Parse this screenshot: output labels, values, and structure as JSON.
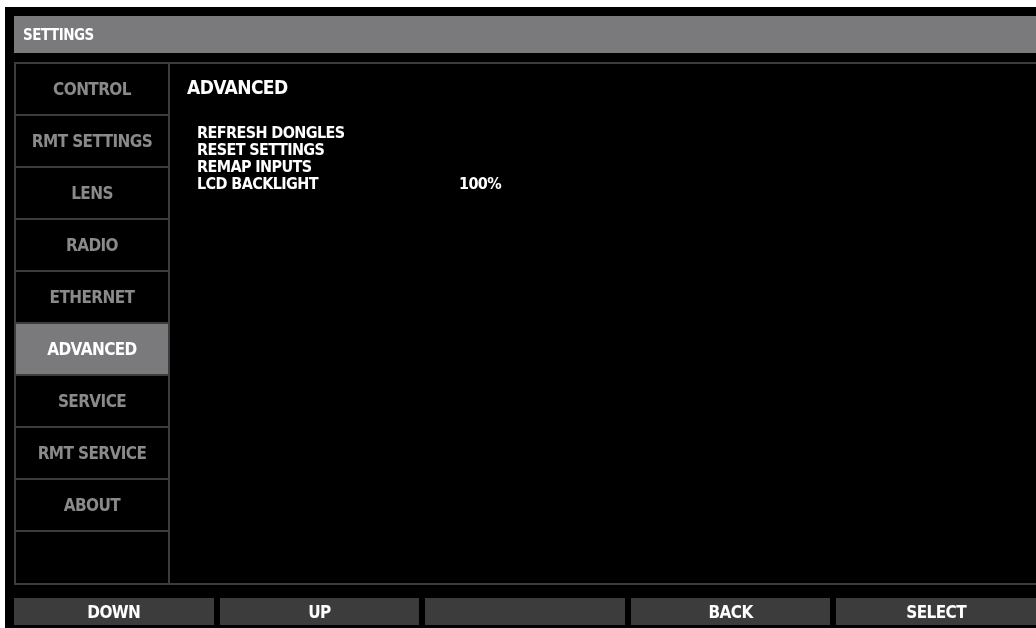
{
  "window": {
    "title": "SETTINGS"
  },
  "sidebar": {
    "items": [
      {
        "label": "CONTROL",
        "selected": false
      },
      {
        "label": "RMT SETTINGS",
        "selected": false
      },
      {
        "label": "LENS",
        "selected": false
      },
      {
        "label": "RADIO",
        "selected": false
      },
      {
        "label": "ETHERNET",
        "selected": false
      },
      {
        "label": "ADVANCED",
        "selected": true
      },
      {
        "label": "SERVICE",
        "selected": false
      },
      {
        "label": "RMT SERVICE",
        "selected": false
      },
      {
        "label": "ABOUT",
        "selected": false
      }
    ]
  },
  "panel": {
    "heading": "ADVANCED",
    "rows": [
      {
        "label": "REFRESH DONGLES"
      },
      {
        "label": "RESET SETTINGS"
      },
      {
        "label": "REMAP INPUTS"
      },
      {
        "label": "LCD BACKLIGHT",
        "value": "100%"
      }
    ]
  },
  "softkeys": [
    {
      "kind": "text",
      "label": "DOWN"
    },
    {
      "kind": "text",
      "label": "UP"
    },
    {
      "kind": "blank"
    },
    {
      "kind": "text",
      "label": "BACK"
    },
    {
      "kind": "text",
      "label": "SELECT"
    }
  ]
}
